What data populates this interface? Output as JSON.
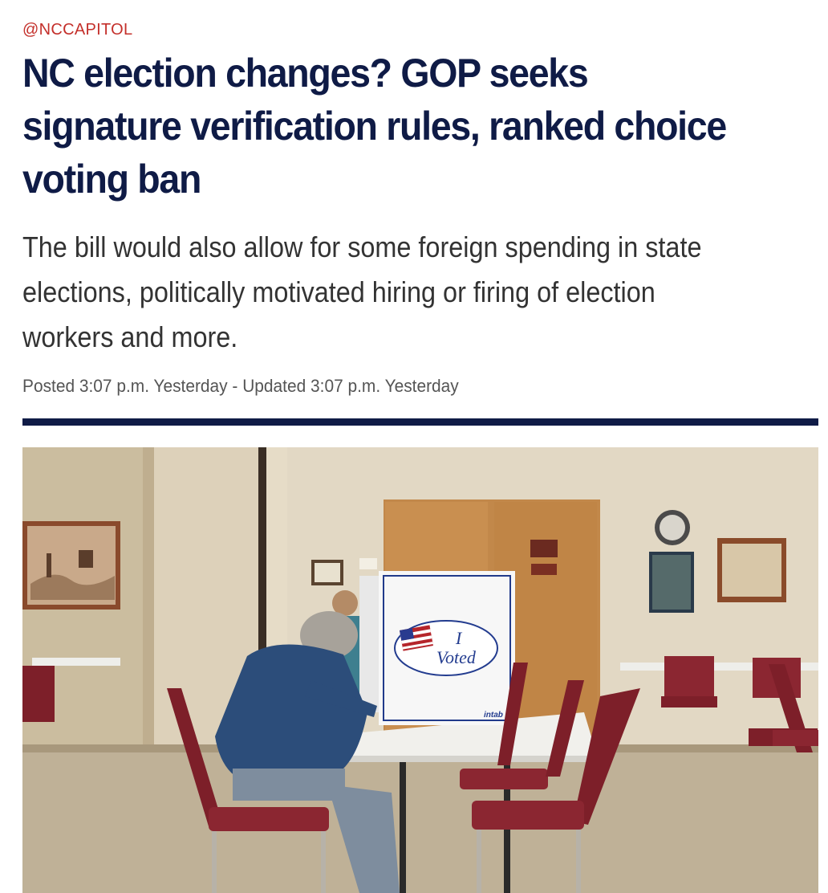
{
  "article": {
    "kicker": "@NCCAPITOL",
    "headline": "NC election changes? GOP seeks signature verification rules, ranked choice voting ban",
    "dek": "The bill would also allow for some foreign spending in state elections, politically motivated hiring or firing of election workers and more.",
    "byline": "Posted 3:07 p.m. Yesterday - Updated 3:07 p.m. Yesterday"
  },
  "photo": {
    "sticker_line1": "I",
    "sticker_line2": "Voted",
    "booth_brand": "intab"
  },
  "colors": {
    "kicker": "#c4302b",
    "headline": "#0f1b46",
    "rule": "#0f1b46"
  }
}
